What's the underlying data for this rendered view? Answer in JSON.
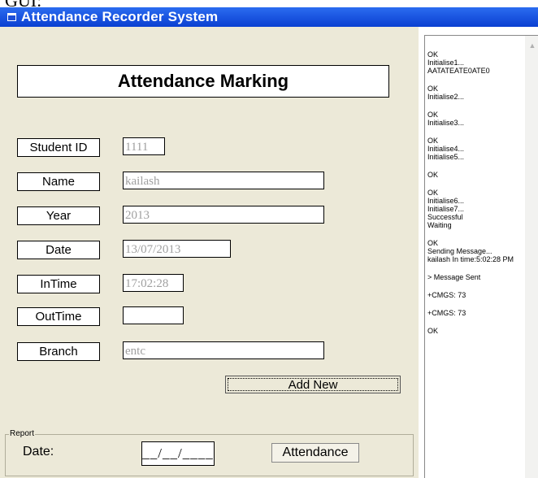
{
  "doc_label": "GUI:",
  "window": {
    "title": "Attendance Recorder System"
  },
  "form": {
    "heading": "Attendance Marking",
    "fields": [
      {
        "label": "Student ID",
        "value": "1111"
      },
      {
        "label": "Name",
        "value": "kailash"
      },
      {
        "label": "Year",
        "value": "2013"
      },
      {
        "label": "Date",
        "value": "13/07/2013"
      },
      {
        "label": "InTime",
        "value": "17:02:28"
      },
      {
        "label": "OutTime",
        "value": ""
      },
      {
        "label": "Branch",
        "value": "entc"
      }
    ],
    "add_new_label": "Add New"
  },
  "report": {
    "legend": "Report",
    "date_label": "Date:",
    "date_value": "__/__/____",
    "attendance_label": "Attendance"
  },
  "log": [
    [
      "OK",
      "Initialise1...",
      "AATATEATE0ATE0"
    ],
    [
      "OK",
      "Initialise2..."
    ],
    [
      "OK",
      "Initialise3..."
    ],
    [
      "OK",
      "Initialise4...",
      "Initialise5..."
    ],
    [
      "OK"
    ],
    [
      "OK",
      "Initialise6...",
      "Initialise7...",
      "Successful",
      "Waiting"
    ],
    [
      "OK",
      "Sending Message...",
      "kailash In time:5:02:28 PM"
    ],
    [
      "> Message Sent"
    ],
    [
      "+CMGS: 73"
    ],
    [
      "+CMGS: 73"
    ],
    [
      "OK"
    ]
  ]
}
